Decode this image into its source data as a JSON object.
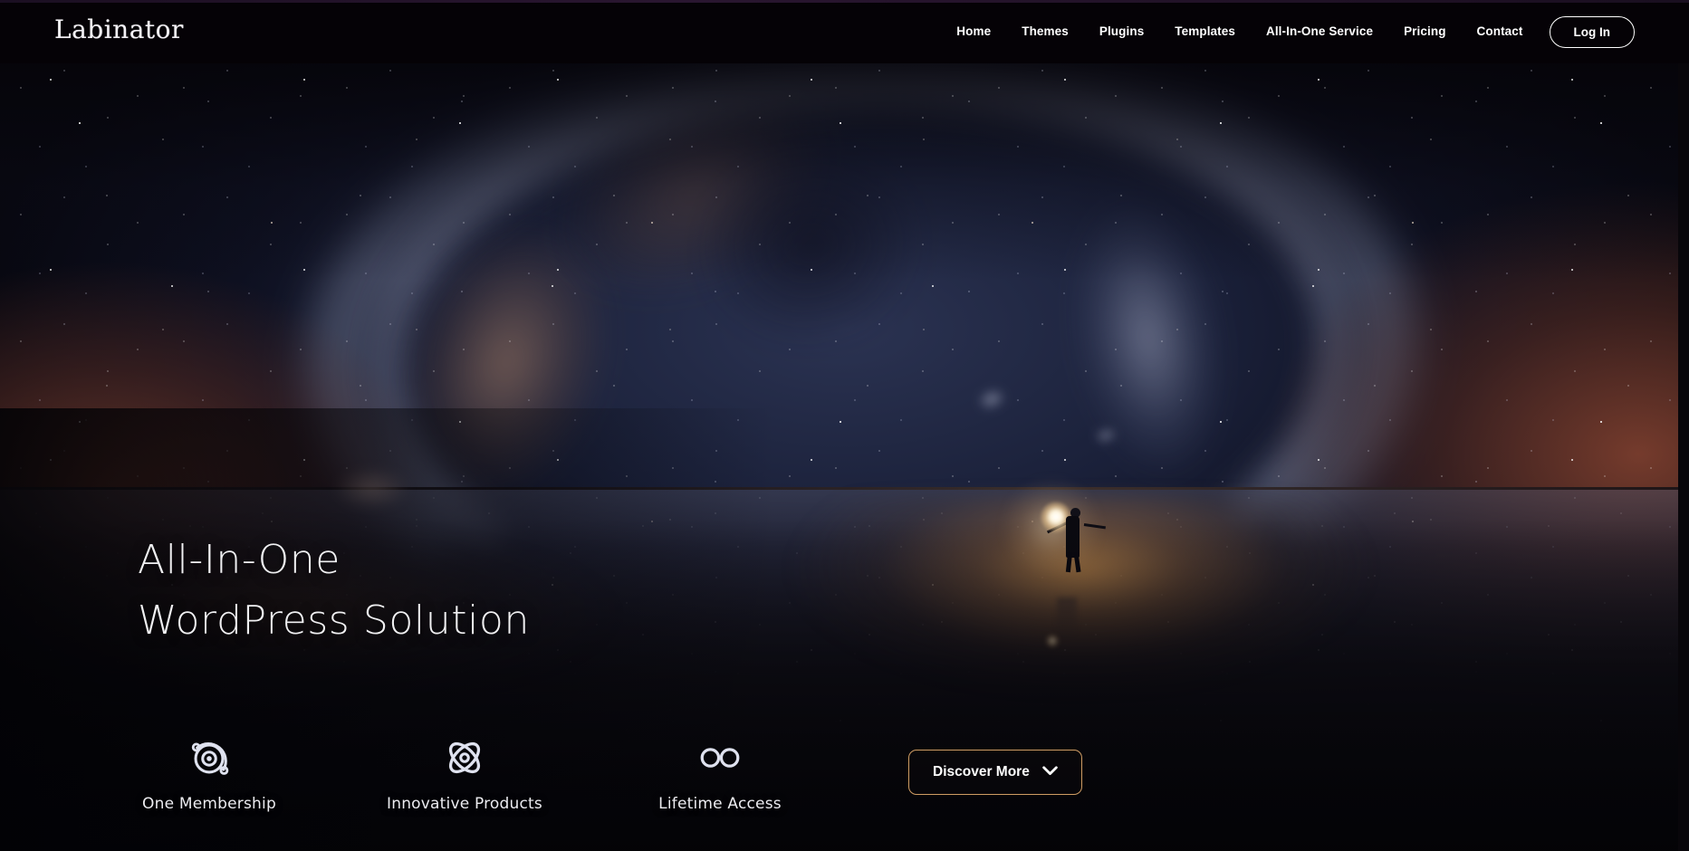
{
  "brand": {
    "name": "Labinator"
  },
  "nav": {
    "links": [
      {
        "label": "Home"
      },
      {
        "label": "Themes"
      },
      {
        "label": "Plugins"
      },
      {
        "label": "Templates"
      },
      {
        "label": "All-In-One Service"
      },
      {
        "label": "Pricing"
      },
      {
        "label": "Contact"
      }
    ],
    "login_label": "Log In"
  },
  "hero": {
    "headline_line1": "All-In-One",
    "headline_line2": "WordPress Solution",
    "features": [
      {
        "label": "One Membership",
        "icon": "orbit-icon"
      },
      {
        "label": "Innovative Products",
        "icon": "atom-icon"
      },
      {
        "label": "Lifetime Access",
        "icon": "infinity-icon"
      }
    ],
    "cta": {
      "label": "Discover More",
      "icon": "chevron-down-icon"
    }
  },
  "colors": {
    "header_bg": "#050206",
    "cta_border": "#cf9c63",
    "text_primary": "#ffffff",
    "headline": "#f0f0f2"
  }
}
